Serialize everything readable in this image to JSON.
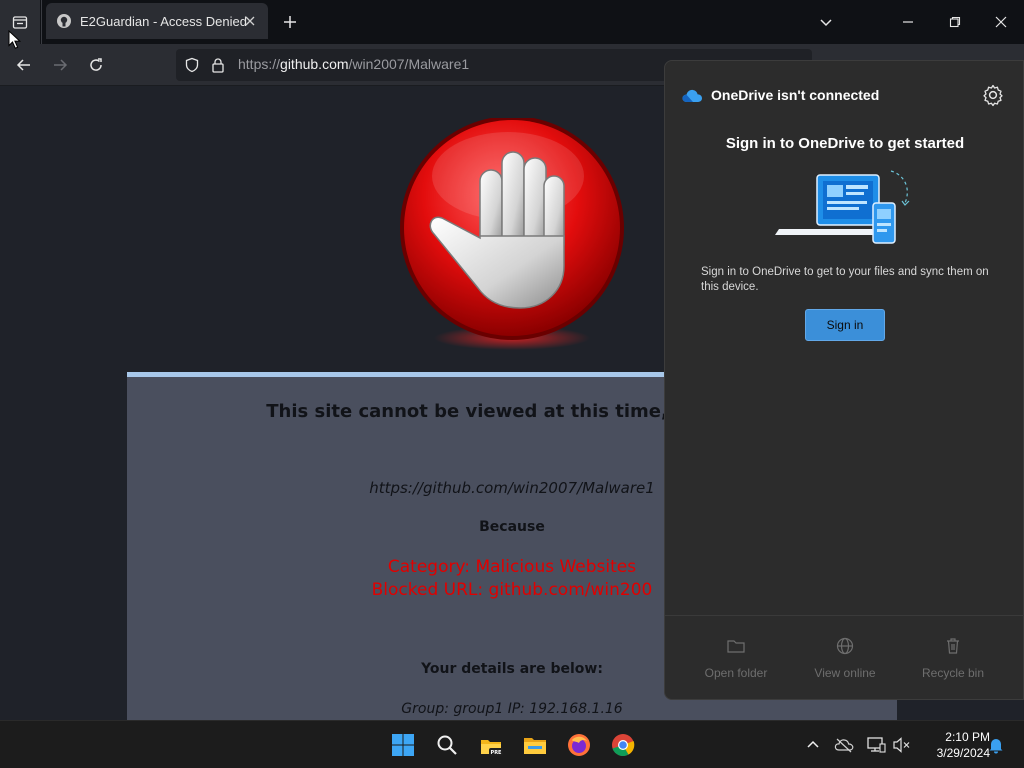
{
  "browser": {
    "tab": {
      "title": "E2Guardian - Access Denied",
      "favicon": "github-icon"
    },
    "address": {
      "prefix": "https://",
      "host": "github.com",
      "path": "/win2007/Malware1"
    }
  },
  "block_page": {
    "heading": "This site cannot be viewed at this time, read bel",
    "blocked_url": "https://github.com/win2007/Malware1",
    "because_label": "Because",
    "category_line": "Category: Malicious Websites",
    "blocked_line": "Blocked URL: github.com/win200",
    "details_label": "Your details are below:",
    "details_line": "Group: group1   IP: 192.168.1.16"
  },
  "onedrive": {
    "title": "OneDrive isn't connected",
    "heading": "Sign in to OneDrive to get started",
    "description": "Sign in to OneDrive to get to your files and sync them on this device.",
    "signin_label": "Sign in",
    "footer": [
      {
        "label": "Open folder",
        "icon": "folder-icon"
      },
      {
        "label": "View online",
        "icon": "globe-icon"
      },
      {
        "label": "Recycle bin",
        "icon": "trash-icon"
      }
    ]
  },
  "taskbar": {
    "apps": [
      "start-icon",
      "search-icon",
      "files-preview-icon",
      "file-explorer-icon",
      "firefox-icon",
      "chrome-icon"
    ],
    "clock": {
      "time": "2:10 PM",
      "date": "3/29/2024"
    }
  },
  "colors": {
    "accent": "#3b8fd9",
    "block_red": "#e00000",
    "panel": "#4a4f5e",
    "panel_top": "#a8c8ea"
  }
}
